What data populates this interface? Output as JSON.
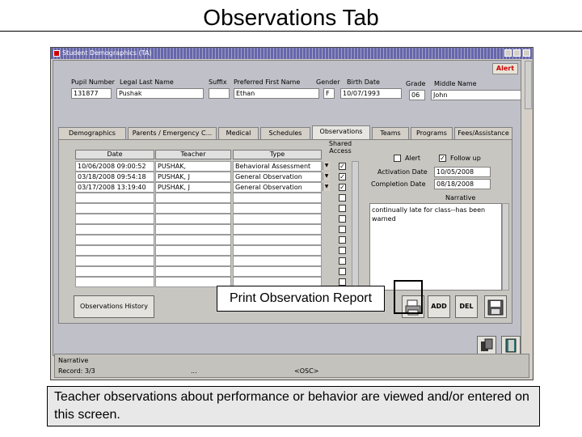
{
  "slide": {
    "title": "Observations Tab",
    "caption": "Teacher observations about performance or behavior are viewed and/or entered on this screen."
  },
  "window": {
    "title": "Student Demographics (TA)"
  },
  "header": {
    "alert_label": "Alert",
    "labels": {
      "pupil_number": "Pupil Number",
      "legal_last_name": "Legal Last Name",
      "suffix": "Suffix",
      "preferred_first_name": "Preferred First Name",
      "gender": "Gender",
      "birth_date": "Birth Date",
      "grade": "Grade",
      "middle_name": "Middle Name"
    },
    "values": {
      "pupil_number": "131877",
      "legal_last_name": "Pushak",
      "suffix": "",
      "preferred_first_name": "Ethan",
      "gender": "F",
      "birth_date": "10/07/1993",
      "grade": "06",
      "middle_name": "John"
    }
  },
  "tabs": [
    "Demographics",
    "Parents / Emergency C...",
    "Medical",
    "Schedules",
    "Observations",
    "Teams",
    "Programs",
    "Fees/Assistance"
  ],
  "observations": {
    "columns": [
      "Date",
      "Teacher",
      "Type",
      "Shared Access"
    ],
    "rows": [
      {
        "date": "10/06/2008 09:00:52",
        "teacher": "PUSHAK,",
        "type": "Behavioral Assessment",
        "shared": true
      },
      {
        "date": "03/18/2008 09:54:18",
        "teacher": "PUSHAK, J",
        "type": "General Observation",
        "shared": true
      },
      {
        "date": "03/17/2008 13:19:40",
        "teacher": "PUSHAK, J",
        "type": "General Observation",
        "shared": true
      },
      {
        "date": "",
        "teacher": "",
        "type": "",
        "shared": false
      },
      {
        "date": "",
        "teacher": "",
        "type": "",
        "shared": false
      },
      {
        "date": "",
        "teacher": "",
        "type": "",
        "shared": false
      },
      {
        "date": "",
        "teacher": "",
        "type": "",
        "shared": false
      },
      {
        "date": "",
        "teacher": "",
        "type": "",
        "shared": false
      },
      {
        "date": "",
        "teacher": "",
        "type": "",
        "shared": false
      },
      {
        "date": "",
        "teacher": "",
        "type": "",
        "shared": false
      },
      {
        "date": "",
        "teacher": "",
        "type": "",
        "shared": false
      },
      {
        "date": "",
        "teacher": "",
        "type": "",
        "shared": false
      }
    ]
  },
  "detail": {
    "alert_label": "Alert",
    "alert_checked": false,
    "follow_up_label": "Follow up",
    "follow_up_checked": true,
    "activation_date_label": "Activation Date",
    "activation_date": "10/05/2008",
    "completion_date_label": "Completion Date",
    "completion_date": "08/18/2008",
    "narrative_label": "Narrative",
    "narrative": "continually late for class--has been warned"
  },
  "buttons": {
    "observations_history": "Observations History",
    "add": "ADD",
    "del": "DEL"
  },
  "callout": {
    "print_report": "Print Observation Report"
  },
  "status": {
    "narrative_label": "Narrative",
    "record": "Record: 3/3",
    "ellipsis": "...",
    "osc": "<OSC>"
  }
}
